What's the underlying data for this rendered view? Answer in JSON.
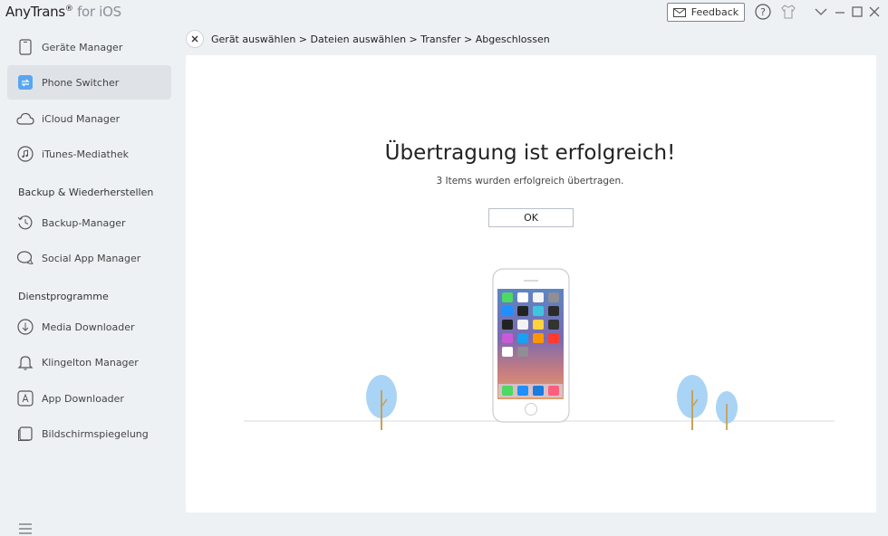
{
  "app": {
    "name": "AnyTrans",
    "reg": "®",
    "suffix": "for iOS"
  },
  "titlebar": {
    "feedback_label": "Feedback"
  },
  "sidebar": {
    "items": [
      {
        "label": "Geräte Manager",
        "icon": "device-icon"
      },
      {
        "label": "Phone Switcher",
        "icon": "phone-switcher-icon"
      },
      {
        "label": "iCloud Manager",
        "icon": "cloud-icon"
      },
      {
        "label": "iTunes-Mediathek",
        "icon": "music-icon"
      }
    ],
    "section_backup": "Backup & Wiederherstellen",
    "backup_items": [
      {
        "label": "Backup-Manager",
        "icon": "history-icon"
      },
      {
        "label": "Social App Manager",
        "icon": "chat-icon"
      }
    ],
    "section_tools": "Dienstprogramme",
    "tool_items": [
      {
        "label": "Media Downloader",
        "icon": "download-icon"
      },
      {
        "label": "Klingelton Manager",
        "icon": "bell-icon"
      },
      {
        "label": "App Downloader",
        "icon": "app-store-icon"
      },
      {
        "label": "Bildschirmspiegelung",
        "icon": "mirror-icon"
      }
    ]
  },
  "breadcrumb": "Gerät auswählen > Dateien auswählen > Transfer > Abgeschlossen",
  "main": {
    "title": "Übertragung ist erfolgreich!",
    "subtitle": "3 Items wurden erfolgreich übertragen.",
    "ok_label": "OK"
  },
  "colors": {
    "accent": "#3b9df0",
    "tree": "#a9d4f5",
    "trunk": "#c8a15a"
  }
}
